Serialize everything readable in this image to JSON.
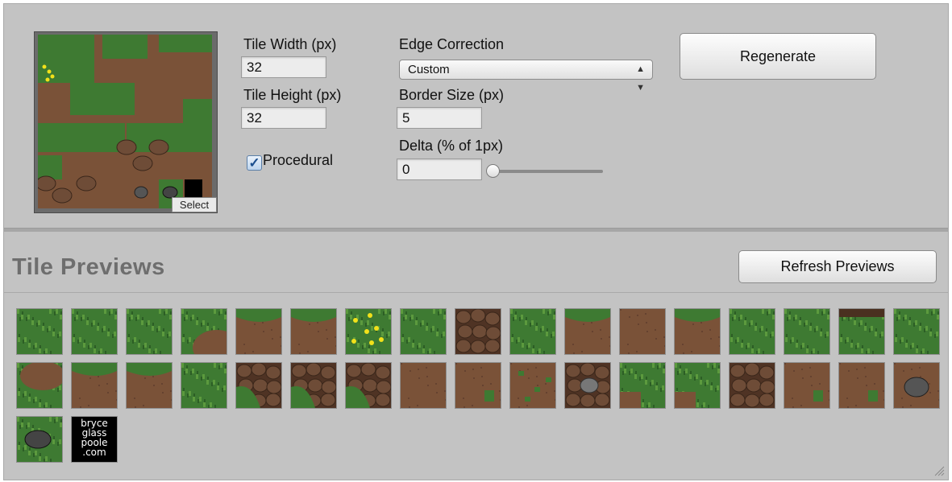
{
  "texture": {
    "select_label": "Select"
  },
  "settings": {
    "tile_width_label": "Tile Width (px)",
    "tile_width_value": "32",
    "tile_height_label": "Tile Height (px)",
    "tile_height_value": "32",
    "procedural_label": "Procedural",
    "procedural_checked": true,
    "edge_correction_label": "Edge Correction",
    "edge_correction_value": "Custom",
    "border_size_label": "Border Size (px)",
    "border_size_value": "5",
    "delta_label": "Delta (% of 1px)",
    "delta_value": "0"
  },
  "actions": {
    "regenerate_label": "Regenerate",
    "refresh_label": "Refresh Previews"
  },
  "previews": {
    "title": "Tile Previews",
    "tiles": [
      "grass",
      "grass",
      "grass",
      "grass-dirt-corner",
      "dirt-grass-edge",
      "dirt-grass-edge",
      "flowers",
      "grass",
      "cobblestone",
      "grass",
      "dirt-grass-edge",
      "dirt",
      "dirt-grass-edge",
      "grass",
      "grass",
      "grass-dirt-spots",
      "grass",
      "grass-dirt-edge",
      "dirt-grass-edge",
      "dirt-grass-edge",
      "grass",
      "cobble-grass",
      "cobble-grass",
      "cobble-grass",
      "dirt",
      "dirt-tuft",
      "dirt-grass-spots",
      "cobble-rock",
      "grass-dirt",
      "grass-dirt",
      "cobblestone",
      "dirt-tuft",
      "dirt-tuft",
      "rock",
      "rock-grass",
      "logo"
    ],
    "logo_lines": [
      "bryce",
      "glass",
      "poole",
      ".com"
    ]
  },
  "colors": {
    "grass": "#3e7a32",
    "dirt": "#7a5238",
    "stone": "#6e4c37",
    "panel": "#c3c3c3",
    "accent": "#1b4f8f"
  }
}
